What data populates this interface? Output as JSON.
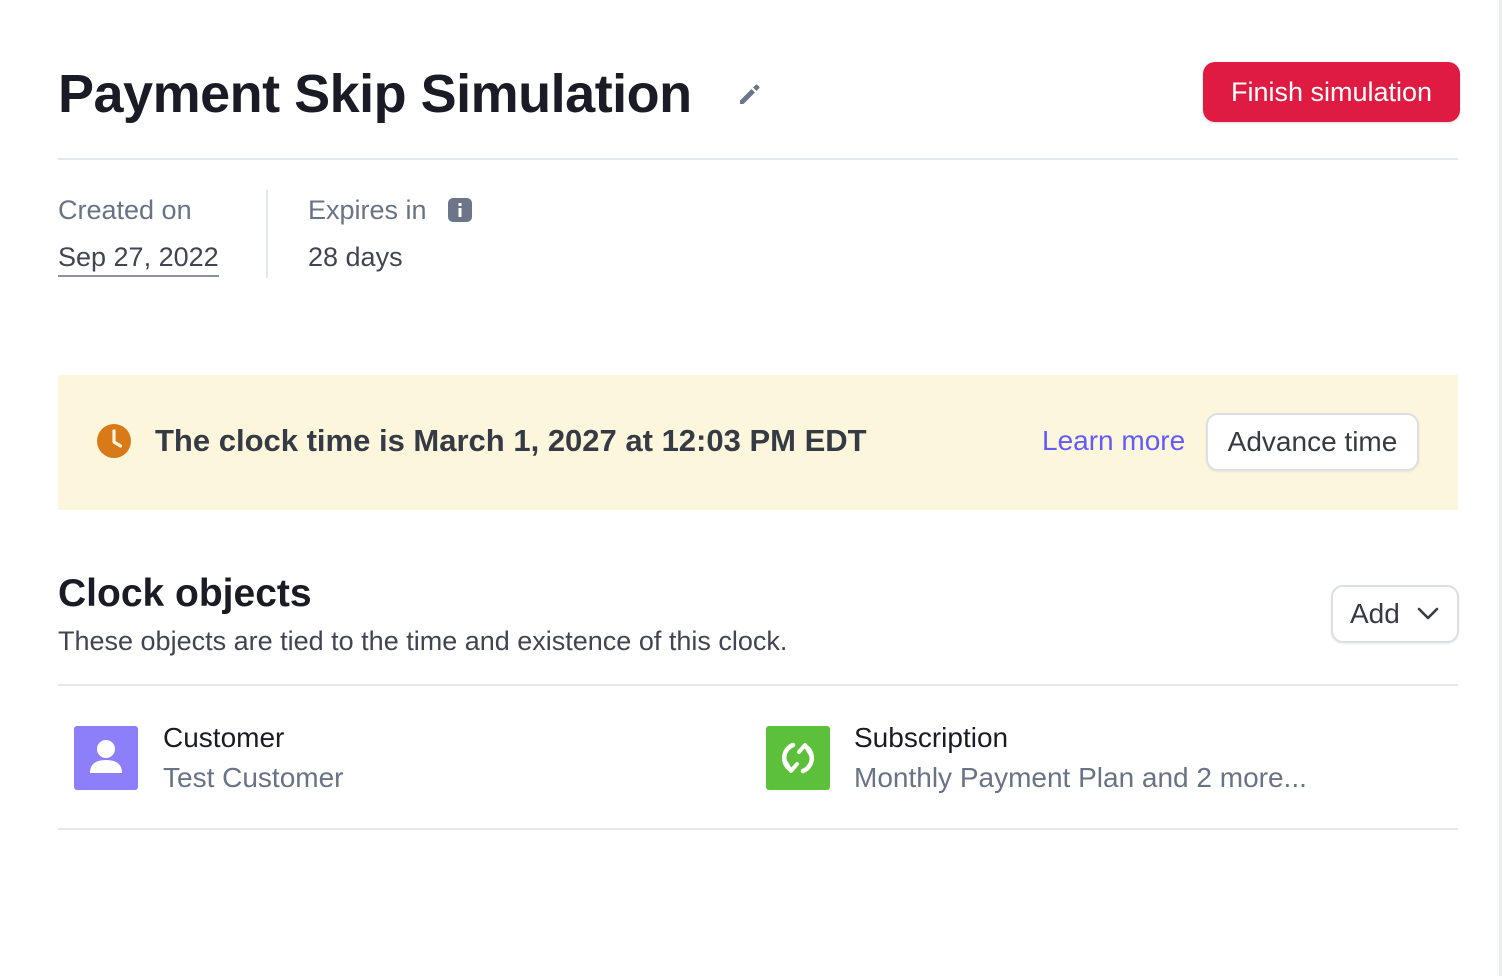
{
  "header": {
    "title": "Payment Skip Simulation",
    "edit_icon": "pencil-icon",
    "finish_button_label": "Finish simulation"
  },
  "meta": {
    "created_label": "Created on",
    "created_value": "Sep 27, 2022",
    "expires_label": "Expires in",
    "expires_info_icon": "info-icon",
    "expires_value": "28 days"
  },
  "banner": {
    "icon": "clock-icon",
    "text": "The clock time is March 1, 2027 at 12:03 PM EDT",
    "learn_more_label": "Learn more",
    "advance_button_label": "Advance time"
  },
  "clock_objects": {
    "title": "Clock objects",
    "description": "These objects are tied to the time and existence of this clock.",
    "add_button_label": "Add",
    "items": [
      {
        "icon": "person-icon",
        "title": "Customer",
        "subtitle": "Test Customer"
      },
      {
        "icon": "refresh-icon",
        "title": "Subscription",
        "subtitle": "Monthly Payment Plan and 2 more..."
      }
    ]
  },
  "colors": {
    "danger": "#df1b41",
    "link": "#625afa",
    "banner_bg": "#fcf7dc",
    "clock_orange": "#d97917",
    "customer_purple": "#8d7ffa",
    "subscription_green": "#5cc03b"
  }
}
